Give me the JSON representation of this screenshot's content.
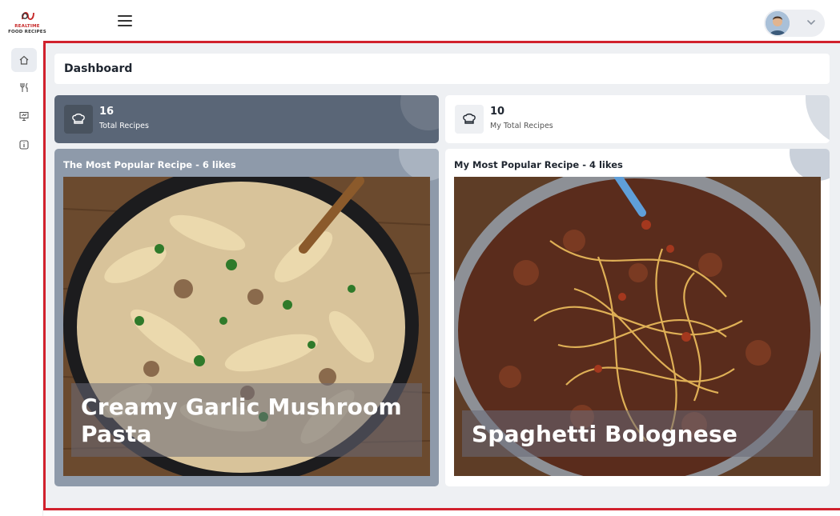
{
  "app": {
    "logo_line1": "REALTIME",
    "logo_line2": "FOOD RECIPES"
  },
  "header": {
    "menu_icon": "hamburger-icon",
    "avatar_icon": "user-avatar",
    "dropdown_icon": "chevron-down-icon"
  },
  "sidebar": {
    "items": [
      {
        "icon": "home-icon",
        "active": true
      },
      {
        "icon": "fork-knife-icon",
        "active": false
      },
      {
        "icon": "presentation-icon",
        "active": false
      },
      {
        "icon": "info-icon",
        "active": false
      }
    ]
  },
  "page": {
    "title": "Dashboard"
  },
  "stats": [
    {
      "value": "16",
      "label": "Total Recipes",
      "icon": "chef-hat-icon"
    },
    {
      "value": "10",
      "label": "My Total Recipes",
      "icon": "chef-hat-icon"
    }
  ],
  "recipes": [
    {
      "heading": "The Most Popular Recipe - 6 likes",
      "name_line1": "Creamy Garlic Mushroom",
      "name_line2": "Pasta"
    },
    {
      "heading": "My Most Popular Recipe - 4 likes",
      "name_line1": "Spaghetti Bolognese",
      "name_line2": ""
    }
  ],
  "colors": {
    "accent_border": "#d1212d",
    "stat_dark": "#5a6677",
    "card_dark": "#8e9aaa",
    "background": "#eef0f3"
  }
}
